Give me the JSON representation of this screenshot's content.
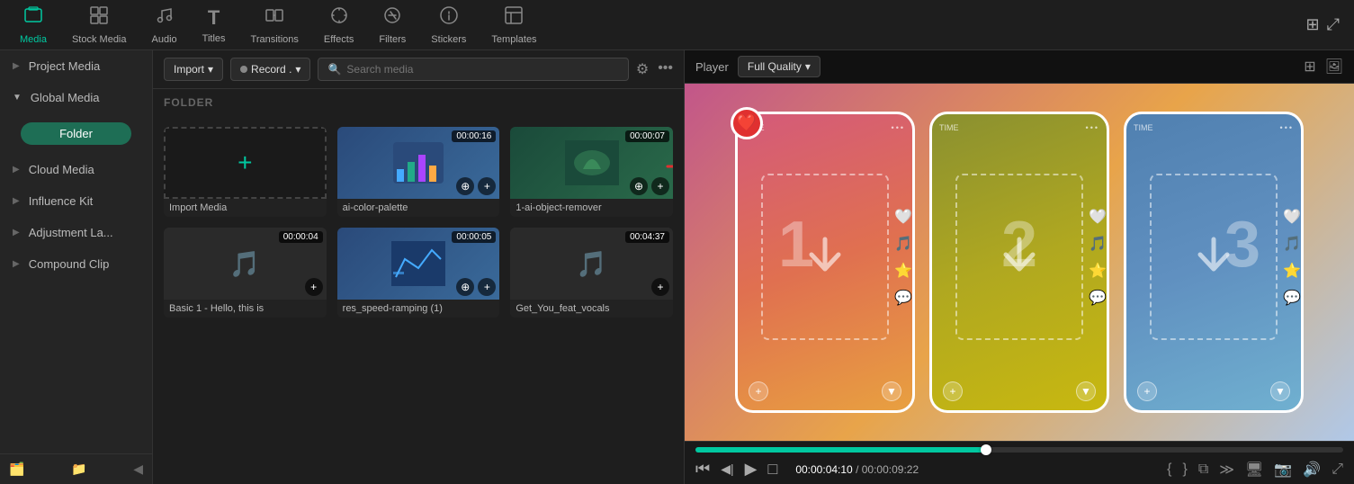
{
  "nav": {
    "items": [
      {
        "id": "media",
        "label": "Media",
        "icon": "🎬",
        "active": true
      },
      {
        "id": "stock-media",
        "label": "Stock Media",
        "icon": "🖼️",
        "active": false
      },
      {
        "id": "audio",
        "label": "Audio",
        "icon": "🎵",
        "active": false
      },
      {
        "id": "titles",
        "label": "Titles",
        "icon": "T",
        "active": false
      },
      {
        "id": "transitions",
        "label": "Transitions",
        "icon": "⧖",
        "active": false
      },
      {
        "id": "effects",
        "label": "Effects",
        "icon": "✨",
        "active": false
      },
      {
        "id": "filters",
        "label": "Filters",
        "icon": "⊕",
        "active": false
      },
      {
        "id": "stickers",
        "label": "Stickers",
        "icon": "🏷️",
        "active": false
      },
      {
        "id": "templates",
        "label": "Templates",
        "icon": "▦",
        "active": false
      }
    ]
  },
  "sidebar": {
    "items": [
      {
        "id": "project-media",
        "label": "Project Media",
        "expandable": true,
        "expanded": false
      },
      {
        "id": "global-media",
        "label": "Global Media",
        "expandable": true,
        "expanded": true
      },
      {
        "id": "folder",
        "label": "Folder",
        "active": true
      },
      {
        "id": "cloud-media",
        "label": "Cloud Media",
        "expandable": true
      },
      {
        "id": "influence-kit",
        "label": "Influence Kit",
        "expandable": true
      },
      {
        "id": "adjustment-la",
        "label": "Adjustment La...",
        "expandable": true
      },
      {
        "id": "compound-clip",
        "label": "Compound Clip",
        "expandable": true
      }
    ],
    "bottom_icons": [
      "➕📁",
      "📁",
      "◀"
    ]
  },
  "toolbar": {
    "import_label": "Import",
    "record_label": "Record .",
    "search_placeholder": "Search media",
    "filter_icon": "filter",
    "more_icon": "more"
  },
  "folder_section": {
    "label": "FOLDER"
  },
  "media_items": [
    {
      "id": "import-media",
      "label": "Import Media",
      "type": "import",
      "duration": null
    },
    {
      "id": "ai-color-palette",
      "label": "ai-color-palette",
      "type": "video",
      "duration": "00:00:16",
      "thumb_type": "blue"
    },
    {
      "id": "1-ai-object-remover",
      "label": "1-ai-object-remover",
      "type": "video",
      "duration": "00:00:07",
      "thumb_type": "teal"
    },
    {
      "id": "basic-1",
      "label": "Basic 1 - Hello, this is",
      "type": "audio",
      "duration": "00:00:04"
    },
    {
      "id": "res-speed-ramping",
      "label": "res_speed-ramping (1)",
      "type": "video",
      "duration": "00:00:05",
      "thumb_type": "blue"
    },
    {
      "id": "get-you-feat-vocals",
      "label": "Get_You_feat_vocals",
      "type": "audio",
      "duration": "00:04:37"
    }
  ],
  "player": {
    "label": "Player",
    "quality": "Full Quality",
    "phone_cards": [
      {
        "id": 1,
        "number": "1",
        "time_label": "TIME",
        "has_heart": true
      },
      {
        "id": 2,
        "number": "2",
        "time_label": "TIME",
        "has_heart": false
      },
      {
        "id": 3,
        "number": "3",
        "time_label": "TIME",
        "has_heart": false
      }
    ],
    "progress_percent": 44.8,
    "time_current": "00:00:04:10",
    "time_total": "00:00:09:22",
    "controls": {
      "rewind": "⏮",
      "step_back": "◀▐",
      "play": "▶",
      "stop": "□"
    }
  }
}
